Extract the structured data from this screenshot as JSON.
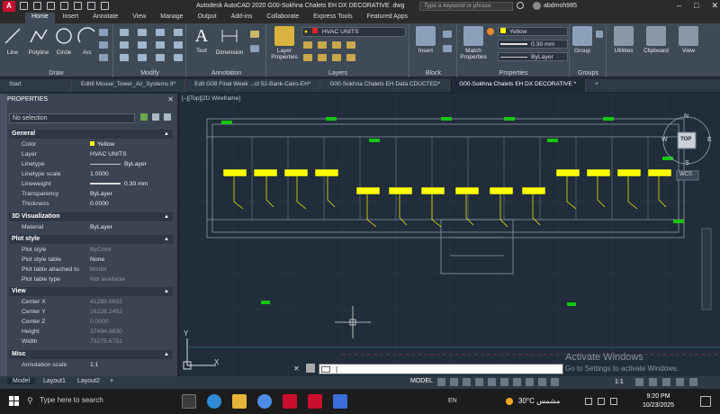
{
  "app": {
    "title": "Autodesk AutoCAD 2020    G00-Sokhna Chalets EH DX DECORATIVE .dwg",
    "search_placeholder": "Type a keyword or phrase",
    "user": "abdmoh985"
  },
  "ribbon_tabs": [
    "Home",
    "Insert",
    "Annotate",
    "View",
    "Manage",
    "Output",
    "Add-ins",
    "Collaborate",
    "Express Tools",
    "Featured Apps"
  ],
  "ribbon": {
    "draw": {
      "label": "Draw",
      "tools": [
        "Line",
        "Polyline",
        "Circle",
        "Arc"
      ]
    },
    "modify": {
      "label": "Modify"
    },
    "annotation": {
      "label": "Annotation",
      "tools": [
        "Text",
        "Dimension"
      ]
    },
    "layers": {
      "label": "Layers",
      "tool": "Layer Properties",
      "current_layer": "HVAC UNITS"
    },
    "block": {
      "label": "Block",
      "tool": "Insert"
    },
    "properties": {
      "label": "Properties",
      "tool": "Match Properties",
      "color": "Yellow",
      "lineweight": "0.30 mm",
      "linetype": "ByLayer"
    },
    "groups": {
      "label": "Groups",
      "tool": "Group"
    },
    "utilities": "Utilities",
    "clipboard": "Clipboard",
    "view": "View"
  },
  "doc_tabs": [
    "Start",
    "Edit8 Mouse_Tower_Air_Systems II*",
    "Edit G08 Final Week ...ct 52-Bank-Cairo-EH*",
    "G00-Sokhna Chalets EH Data CDUCTED*",
    "G00-Sokhna Chalets EH DX DECORATIVE *"
  ],
  "properties": {
    "header": "PROPERTIES",
    "selection": "No selection",
    "sections": {
      "general": {
        "title": "General",
        "rows": [
          {
            "k": "Color",
            "v": "Yellow"
          },
          {
            "k": "Layer",
            "v": "HVAC UNITS"
          },
          {
            "k": "Linetype",
            "v": "ByLayer"
          },
          {
            "k": "Linetype scale",
            "v": "1.0000"
          },
          {
            "k": "Lineweight",
            "v": "0.30 mm"
          },
          {
            "k": "Transparency",
            "v": "ByLayer"
          },
          {
            "k": "Thickness",
            "v": "0.0000"
          }
        ]
      },
      "viz": {
        "title": "3D Visualization",
        "rows": [
          {
            "k": "Material",
            "v": "ByLayer"
          }
        ]
      },
      "plot": {
        "title": "Plot style",
        "rows": [
          {
            "k": "Plot style",
            "v": "ByColor"
          },
          {
            "k": "Plot style table",
            "v": "None"
          },
          {
            "k": "Plot table attached to",
            "v": "Model"
          },
          {
            "k": "Plot table type",
            "v": "Not available"
          }
        ]
      },
      "view": {
        "title": "View",
        "rows": [
          {
            "k": "Center X",
            "v": "41289.6692"
          },
          {
            "k": "Center Y",
            "v": "16226.2452"
          },
          {
            "k": "Center Z",
            "v": "0.0000"
          },
          {
            "k": "Height",
            "v": "37494.8830"
          },
          {
            "k": "Width",
            "v": "73275.6751"
          }
        ]
      },
      "misc": {
        "title": "Misc",
        "rows": [
          {
            "k": "Annotation scale",
            "v": "1:1"
          }
        ]
      }
    }
  },
  "canvas": {
    "viewport_label": "[–][Top][2D Wireframe]",
    "viewcube": {
      "top": "TOP",
      "n": "N",
      "s": "S",
      "e": "E",
      "w": "W",
      "wcs": "WCS"
    },
    "ucs_x": "X",
    "ucs_y": "Y"
  },
  "layouts": [
    "Model",
    "Layout1",
    "Layout2"
  ],
  "status": {
    "model": "MODEL",
    "scale": "1:1"
  },
  "watermark": {
    "line1": "Activate Windows",
    "line2": "Go to Settings to activate Windows."
  },
  "taskbar": {
    "search": "Type here to search",
    "lang": "EN",
    "weather": "30°C  مشمس",
    "time": "9:20 PM",
    "date": "10/23/2025"
  },
  "colors": {
    "accent_yellow": "#ffff00",
    "green_mark": "#16c60c",
    "layer_red": "#e0202a"
  }
}
